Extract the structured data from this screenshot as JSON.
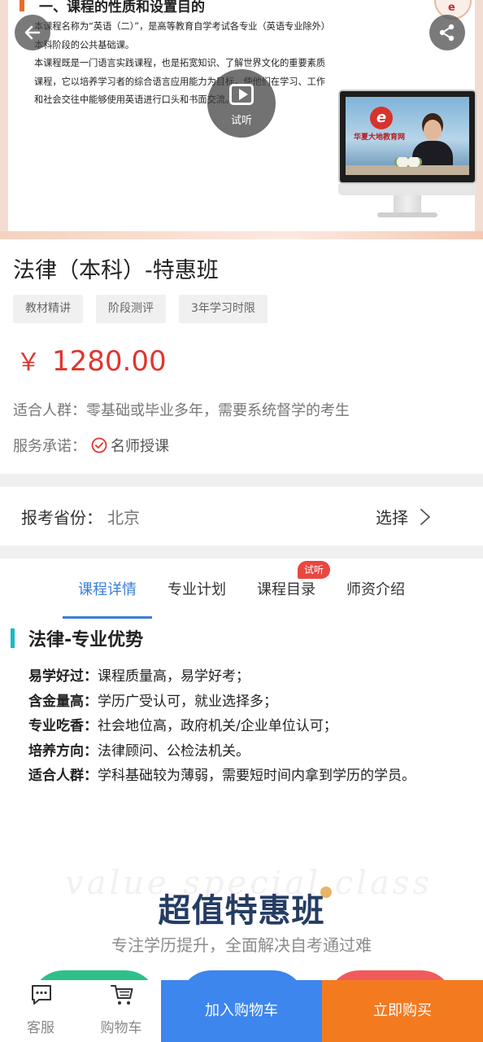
{
  "banner": {
    "heading": "一、课程的性质和设置目的",
    "paragraphs": [
      "本课程名称为“英语（二）”，是高等教育自学考试各专业（英语专业除外）本科阶段的公共基础课。",
      "本课程既是一门语言实践课程，也是拓宽知识、了解世界文化的重要素质课程，它以培养学习者的综合语言应用能力为目标，使他们在学习、工作和社会交往中能够使用英语进行口头和书面交流。"
    ],
    "monitor_site_name": "华夏大地教育网",
    "logo_glyph": "e",
    "play_label": "试听"
  },
  "product": {
    "title": "法律（本科）-特惠班",
    "tags": [
      "教材精讲",
      "阶段测评",
      "3年学习时限"
    ],
    "currency": "￥",
    "price": "1280.00",
    "audience": "适合人群：零基础或毕业多年，需要系统督学的考生",
    "service_label": "服务承诺：",
    "service_value": "名师授课"
  },
  "province": {
    "label": "报考省份：",
    "value": "北京",
    "select_label": "选择"
  },
  "tabs": {
    "items": [
      "课程详情",
      "专业计划",
      "课程目录",
      "师资介绍"
    ],
    "active_index": 0,
    "badge": "试听"
  },
  "details": {
    "section_title": "法律-专业优势",
    "features": [
      {
        "key": "易学好过：",
        "value": "课程质量高，易学好考；"
      },
      {
        "key": "含金量高：",
        "value": "学历广受认可，就业选择多；"
      },
      {
        "key": "专业吃香：",
        "value": "社会地位高，政府机关/企业单位认可；"
      },
      {
        "key": "培养方向：",
        "value": "法律顾问、公检法机关。"
      },
      {
        "key": "适合人群：",
        "value": "学科基础较为薄弱，需要短时间内拿到学历的学员。"
      }
    ]
  },
  "promo": {
    "watermark": "value special class",
    "title": "超值特惠班",
    "subtitle": "专注学历提升，全面解决自考通过难"
  },
  "bottom_bar": {
    "service_label": "客服",
    "cart_label": "购物车",
    "add_cart_button": "加入购物车",
    "buy_button": "立即购买"
  },
  "colors": {
    "price": "#e1352f",
    "active_tab": "#3b7dd8",
    "add_cart": "#3d86ee",
    "buy_now": "#f47a20",
    "section_accent": "#1bb8c8"
  },
  "icons": [
    "back-arrow-icon",
    "share-icon",
    "play-icon",
    "check-circle-icon",
    "chevron-right-icon",
    "chat-icon",
    "cart-icon"
  ]
}
